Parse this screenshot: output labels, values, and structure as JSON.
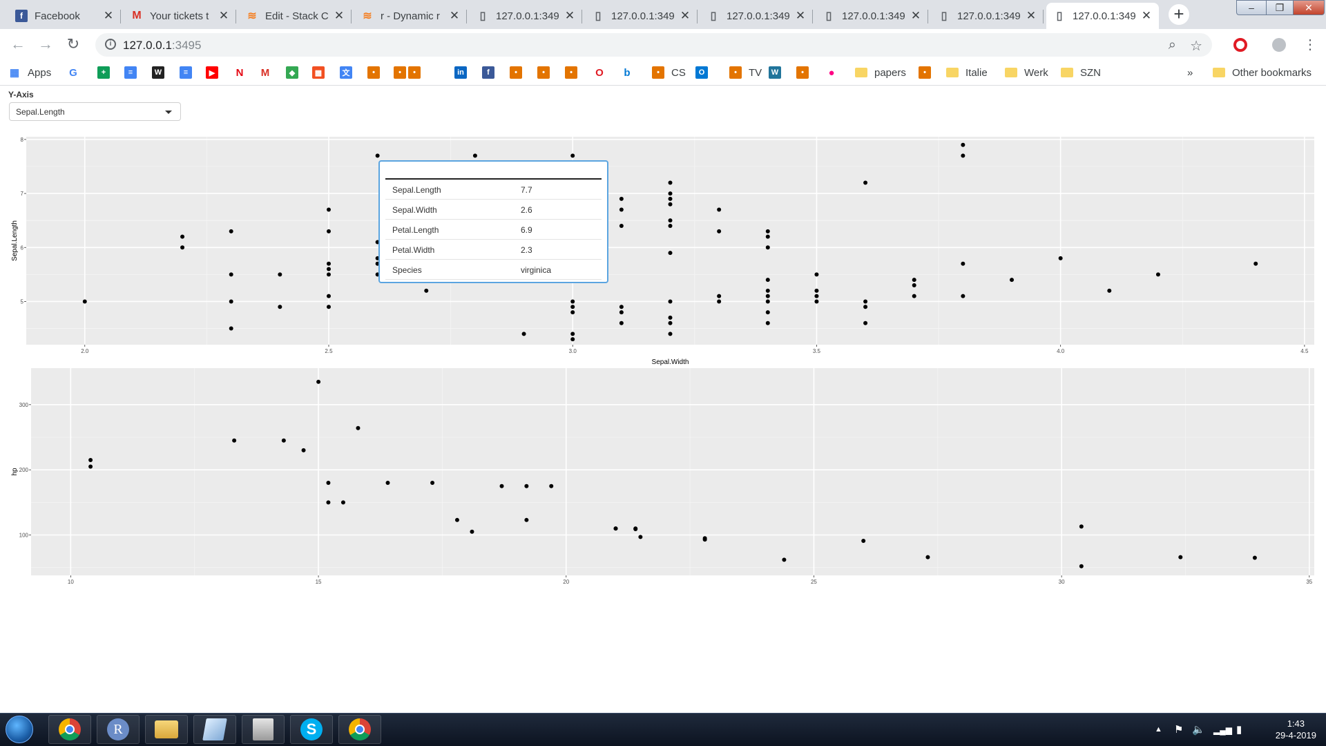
{
  "tabs": [
    {
      "title": "Facebook",
      "icon": "facebook-icon",
      "color": "#3b5998",
      "glyph": "f"
    },
    {
      "title": "Your tickets t",
      "icon": "gmail-icon",
      "color": "#ffffff",
      "glyph": "M"
    },
    {
      "title": "Edit - Stack C",
      "icon": "stackoverflow-icon",
      "color": "#ffffff",
      "glyph": "≋"
    },
    {
      "title": "r - Dynamic r",
      "icon": "stackoverflow-icon",
      "color": "#ffffff",
      "glyph": "≋"
    },
    {
      "title": "127.0.0.1:349",
      "icon": "page-icon",
      "color": "#ffffff",
      "glyph": "▯"
    },
    {
      "title": "127.0.0.1:349",
      "icon": "page-icon",
      "color": "#ffffff",
      "glyph": "▯"
    },
    {
      "title": "127.0.0.1:349",
      "icon": "page-icon",
      "color": "#ffffff",
      "glyph": "▯"
    },
    {
      "title": "127.0.0.1:349",
      "icon": "page-icon",
      "color": "#ffffff",
      "glyph": "▯"
    },
    {
      "title": "127.0.0.1:349",
      "icon": "page-icon",
      "color": "#ffffff",
      "glyph": "▯"
    },
    {
      "title": "127.0.0.1:349",
      "icon": "page-icon",
      "color": "#ffffff",
      "glyph": "▯"
    }
  ],
  "address": {
    "host": "127.0.0.1",
    "port": ":3495"
  },
  "bookmarks": [
    {
      "label": "Apps",
      "icon": "apps-grid-icon"
    },
    {
      "label": "",
      "icon": "google-icon"
    },
    {
      "label": "",
      "icon": "sheets-icon"
    },
    {
      "label": "",
      "icon": "docs-icon"
    },
    {
      "label": "",
      "icon": "wiki-icon"
    },
    {
      "label": "",
      "icon": "docs-icon"
    },
    {
      "label": "",
      "icon": "youtube-icon"
    },
    {
      "label": "",
      "icon": "netflix-icon"
    },
    {
      "label": "",
      "icon": "gmail-icon"
    },
    {
      "label": "",
      "icon": "maps-icon"
    },
    {
      "label": "",
      "icon": "microsoft-icon"
    },
    {
      "label": "",
      "icon": "translate-icon"
    },
    {
      "label": "",
      "icon": "bookmark-icon"
    },
    {
      "label": "",
      "icon": "bookmark-icon"
    },
    {
      "label": "",
      "icon": "bookmark-icon"
    },
    {
      "label": "",
      "icon": "linkedin-icon"
    },
    {
      "label": "",
      "icon": "facebook-icon"
    },
    {
      "label": "",
      "icon": "bookmark-icon"
    },
    {
      "label": "",
      "icon": "bookmark-icon"
    },
    {
      "label": "",
      "icon": "bookmark-icon"
    },
    {
      "label": "",
      "icon": "opera-icon"
    },
    {
      "label": "",
      "icon": "bing-icon"
    },
    {
      "label": "CS",
      "icon": "bookmark-icon"
    },
    {
      "label": "",
      "icon": "outlook-icon"
    },
    {
      "label": "TV",
      "icon": "bookmark-icon"
    },
    {
      "label": "",
      "icon": "wordpress-icon"
    },
    {
      "label": "",
      "icon": "bookmark-icon"
    },
    {
      "label": "",
      "icon": "flickr-icon"
    },
    {
      "label": "papers",
      "icon": "folder-icon"
    },
    {
      "label": "",
      "icon": "bookmark-icon"
    },
    {
      "label": "Italie",
      "icon": "folder-icon"
    },
    {
      "label": "Werk",
      "icon": "folder-icon"
    },
    {
      "label": "SZN",
      "icon": "folder-icon"
    }
  ],
  "bookmarks_overflow": "»",
  "other_bookmarks": "Other bookmarks",
  "controls": {
    "yaxis_label": "Y-Axis",
    "yaxis_value": "Sepal.Length"
  },
  "tooltip": {
    "rows": [
      {
        "key": "Sepal.Length",
        "value": "7.7"
      },
      {
        "key": "Sepal.Width",
        "value": "2.6"
      },
      {
        "key": "Petal.Length",
        "value": "6.9"
      },
      {
        "key": "Petal.Width",
        "value": "2.3"
      },
      {
        "key": "Species",
        "value": "virginica"
      }
    ]
  },
  "chart_data": [
    {
      "type": "scatter",
      "xlabel": "Sepal.Width",
      "ylabel": "Sepal.Length",
      "xlim": [
        1.88,
        4.52
      ],
      "ylim": [
        4.2,
        8.05
      ],
      "xticks": [
        2.0,
        2.5,
        3.0,
        3.5,
        4.0,
        4.5
      ],
      "xtick_labels": [
        "2.0",
        "2.5",
        "3.0",
        "3.5",
        "4.0",
        "4.5"
      ],
      "yticks": [
        5,
        6,
        7,
        8
      ],
      "ytick_labels": [
        "5",
        "6",
        "7",
        "8"
      ],
      "grid": true,
      "points": [
        [
          2.0,
          5.0
        ],
        [
          2.2,
          6.2
        ],
        [
          2.2,
          6.0
        ],
        [
          2.3,
          6.3
        ],
        [
          2.3,
          5.5
        ],
        [
          2.3,
          5.0
        ],
        [
          2.3,
          4.5
        ],
        [
          2.4,
          5.5
        ],
        [
          2.4,
          4.9
        ],
        [
          2.5,
          6.7
        ],
        [
          2.5,
          6.3
        ],
        [
          2.5,
          5.7
        ],
        [
          2.5,
          5.6
        ],
        [
          2.5,
          5.5
        ],
        [
          2.5,
          5.1
        ],
        [
          2.5,
          4.9
        ],
        [
          2.6,
          7.7
        ],
        [
          2.6,
          6.1
        ],
        [
          2.6,
          5.8
        ],
        [
          2.6,
          5.7
        ],
        [
          2.6,
          5.5
        ],
        [
          2.7,
          5.2
        ],
        [
          2.8,
          7.7
        ],
        [
          2.9,
          4.4
        ],
        [
          3.0,
          7.7
        ],
        [
          3.0,
          5.0
        ],
        [
          3.0,
          4.9
        ],
        [
          3.0,
          4.8
        ],
        [
          3.0,
          4.4
        ],
        [
          3.0,
          4.3
        ],
        [
          3.1,
          6.9
        ],
        [
          3.1,
          6.7
        ],
        [
          3.1,
          6.4
        ],
        [
          3.1,
          4.9
        ],
        [
          3.1,
          4.8
        ],
        [
          3.1,
          4.6
        ],
        [
          3.2,
          7.2
        ],
        [
          3.2,
          7.0
        ],
        [
          3.2,
          6.9
        ],
        [
          3.2,
          6.8
        ],
        [
          3.2,
          6.5
        ],
        [
          3.2,
          6.4
        ],
        [
          3.2,
          5.9
        ],
        [
          3.2,
          5.0
        ],
        [
          3.2,
          4.7
        ],
        [
          3.2,
          4.6
        ],
        [
          3.2,
          4.4
        ],
        [
          3.3,
          6.7
        ],
        [
          3.3,
          6.3
        ],
        [
          3.3,
          5.1
        ],
        [
          3.3,
          5.0
        ],
        [
          3.4,
          6.3
        ],
        [
          3.4,
          6.2
        ],
        [
          3.4,
          6.0
        ],
        [
          3.4,
          5.4
        ],
        [
          3.4,
          5.2
        ],
        [
          3.4,
          5.1
        ],
        [
          3.4,
          5.0
        ],
        [
          3.4,
          4.8
        ],
        [
          3.4,
          4.6
        ],
        [
          3.5,
          5.5
        ],
        [
          3.5,
          5.2
        ],
        [
          3.5,
          5.1
        ],
        [
          3.5,
          5.0
        ],
        [
          3.6,
          7.2
        ],
        [
          3.6,
          5.0
        ],
        [
          3.6,
          4.9
        ],
        [
          3.6,
          4.6
        ],
        [
          3.7,
          5.4
        ],
        [
          3.7,
          5.3
        ],
        [
          3.7,
          5.1
        ],
        [
          3.8,
          7.9
        ],
        [
          3.8,
          7.7
        ],
        [
          3.8,
          5.7
        ],
        [
          3.8,
          5.1
        ],
        [
          3.9,
          5.4
        ],
        [
          4.0,
          5.8
        ],
        [
          4.1,
          5.2
        ],
        [
          4.2,
          5.5
        ],
        [
          4.4,
          5.7
        ]
      ]
    },
    {
      "type": "scatter",
      "xlabel": "mpg",
      "ylabel": "hp",
      "xlim": [
        9.2,
        35.1
      ],
      "ylim": [
        38,
        356
      ],
      "xticks": [
        10,
        15,
        20,
        25,
        30,
        35
      ],
      "xtick_labels": [
        "10",
        "15",
        "20",
        "25",
        "30",
        "35"
      ],
      "yticks": [
        100,
        200,
        300
      ],
      "ytick_labels": [
        "100",
        "200",
        "300"
      ],
      "grid": true,
      "points": [
        [
          21.0,
          110
        ],
        [
          21.0,
          110
        ],
        [
          22.8,
          93
        ],
        [
          21.4,
          110
        ],
        [
          18.7,
          175
        ],
        [
          18.1,
          105
        ],
        [
          14.3,
          245
        ],
        [
          24.4,
          62
        ],
        [
          22.8,
          95
        ],
        [
          19.2,
          123
        ],
        [
          17.8,
          123
        ],
        [
          16.4,
          180
        ],
        [
          17.3,
          180
        ],
        [
          15.2,
          180
        ],
        [
          10.4,
          205
        ],
        [
          10.4,
          215
        ],
        [
          14.7,
          230
        ],
        [
          32.4,
          66
        ],
        [
          30.4,
          52
        ],
        [
          33.9,
          65
        ],
        [
          21.5,
          97
        ],
        [
          15.5,
          150
        ],
        [
          15.2,
          150
        ],
        [
          13.3,
          245
        ],
        [
          19.2,
          175
        ],
        [
          27.3,
          66
        ],
        [
          26.0,
          91
        ],
        [
          30.4,
          113
        ],
        [
          15.8,
          264
        ],
        [
          19.7,
          175
        ],
        [
          15.0,
          335
        ],
        [
          21.4,
          109
        ]
      ]
    }
  ],
  "taskbar": {
    "apps": [
      {
        "name": "chrome",
        "icon": "chrome-icon"
      },
      {
        "name": "r",
        "icon": "r-icon",
        "glyph": "R"
      },
      {
        "name": "explorer",
        "icon": "folder-icon"
      },
      {
        "name": "notepad",
        "icon": "notepad-icon"
      },
      {
        "name": "files",
        "icon": "file-cabinet-icon"
      },
      {
        "name": "skype",
        "icon": "skype-icon",
        "glyph": "S"
      },
      {
        "name": "chrome2",
        "icon": "chrome-icon"
      }
    ],
    "time": "1:43",
    "date": "29-4-2019"
  }
}
